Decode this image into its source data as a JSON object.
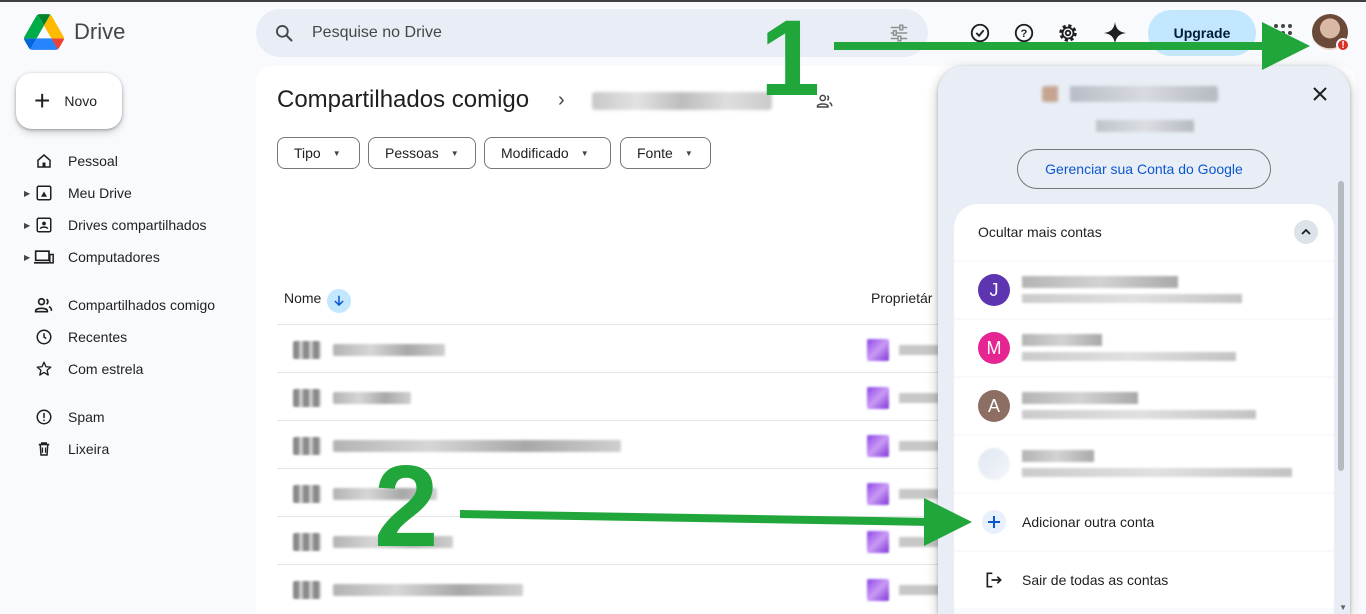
{
  "app": {
    "name": "Drive"
  },
  "search": {
    "placeholder": "Pesquise no Drive"
  },
  "header": {
    "upgrade_label": "Upgrade"
  },
  "sidebar": {
    "new_label": "Novo",
    "items": [
      {
        "label": "Pessoal",
        "icon": "home-icon"
      },
      {
        "label": "Meu Drive",
        "icon": "my-drive-icon"
      },
      {
        "label": "Drives compartilhados",
        "icon": "shared-drives-icon"
      },
      {
        "label": "Computadores",
        "icon": "computers-icon"
      },
      {
        "label": "Compartilhados comigo",
        "icon": "people-icon"
      },
      {
        "label": "Recentes",
        "icon": "clock-icon"
      },
      {
        "label": "Com estrela",
        "icon": "star-icon"
      },
      {
        "label": "Spam",
        "icon": "spam-icon"
      },
      {
        "label": "Lixeira",
        "icon": "trash-icon"
      }
    ]
  },
  "main": {
    "breadcrumb": "Compartilhados comigo",
    "filters": [
      "Tipo",
      "Pessoas",
      "Modificado",
      "Fonte"
    ],
    "columns": {
      "name": "Nome",
      "owner": "Proprietár"
    }
  },
  "account_panel": {
    "manage_label": "Gerenciar sua Conta do Google",
    "hide_accounts_label": "Ocultar mais contas",
    "accounts": [
      {
        "initial": "J",
        "color": "#5e35b1"
      },
      {
        "initial": "M",
        "color": "#e52592"
      },
      {
        "initial": "A",
        "color": "#8d6e63"
      }
    ],
    "add_account_label": "Adicionar outra conta",
    "sign_out_label": "Sair de todas as contas"
  },
  "annotations": {
    "step1": "1",
    "step2": "2",
    "color": "#21a63b"
  }
}
